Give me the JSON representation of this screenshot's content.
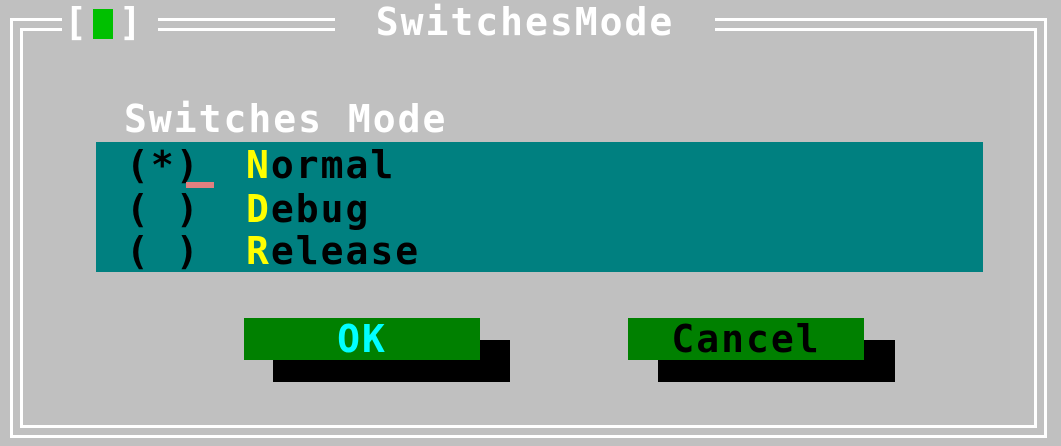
{
  "dialog": {
    "title": "SwitchesMode",
    "close_box": {
      "left": "[",
      "right": "]",
      "icon": "close-box-icon"
    },
    "group_label": "Switches Mode",
    "options": [
      {
        "mark": "(*)",
        "hotkey": "N",
        "rest": "ormal",
        "selected": true
      },
      {
        "mark": "( )",
        "hotkey": "D",
        "rest": "ebug",
        "selected": false
      },
      {
        "mark": "( )",
        "hotkey": "R",
        "rest": "elease",
        "selected": false
      }
    ],
    "buttons": {
      "ok_label": "OK",
      "cancel_label": "Cancel"
    }
  },
  "colors": {
    "background": "#c0c0c0",
    "frame": "#ffffff",
    "cluster": "#008080",
    "hotkey": "#ffff00",
    "button": "#008000",
    "default_button_text": "#00ffff",
    "close_mark": "#00c000"
  }
}
